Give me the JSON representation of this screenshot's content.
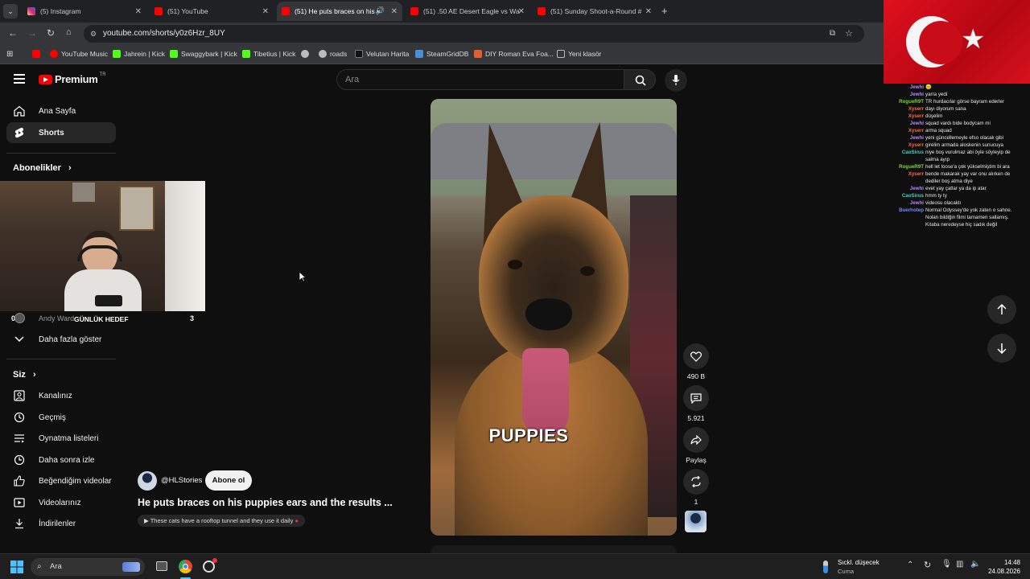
{
  "browser": {
    "tabs": [
      {
        "label": "(5) Instagram",
        "color": "#e1306c"
      },
      {
        "label": "(51) YouTube",
        "color": "#ff0000"
      },
      {
        "label": "(51) He puts braces on his p",
        "color": "#ff0000"
      },
      {
        "label": "(51) .50 AE Desert Eagle vs Wat",
        "color": "#ff0000"
      },
      {
        "label": "(51) Sunday Shoot-a-Round # ",
        "color": "#ff0000"
      }
    ],
    "url": "youtube.com/shorts/y0z6Hzr_8UY",
    "bookmarks": [
      {
        "label": "YouTube Music",
        "color": "#ff0000"
      },
      {
        "label": "Jahrein | Kick",
        "color": "#53fc18"
      },
      {
        "label": "Swaggybark | Kick",
        "color": "#53fc18"
      },
      {
        "label": "Tibetius | Kick",
        "color": "#53fc18"
      },
      {
        "label": "roads",
        "color": "#bbbbbb"
      },
      {
        "label": "Velutan Harita",
        "color": "#333333"
      },
      {
        "label": "SteamGridDB",
        "color": "#4a90d9"
      },
      {
        "label": "DIY Roman Eva Foa...",
        "color": "#e06030"
      },
      {
        "label": "Yeni klasör",
        "color": "#bbbbbb"
      }
    ]
  },
  "header": {
    "brand": "Premium",
    "region": "TR",
    "search_placeholder": "Ara"
  },
  "sidebar": {
    "top": [
      {
        "label": "Ana Sayfa"
      },
      {
        "label": "Shorts"
      }
    ],
    "subscriptions_title": "Abonelikler",
    "channel_partial": "Andy Ward",
    "overlay_goal_label": "GÜNLÜK HEDEF",
    "overlay_left": "0",
    "overlay_right": "3",
    "show_more": "Daha fazla göster",
    "you_title": "Siz",
    "you_items": [
      {
        "label": "Kanalınız"
      },
      {
        "label": "Geçmiş"
      },
      {
        "label": "Oynatma listeleri"
      },
      {
        "label": "Daha sonra izle"
      },
      {
        "label": "Beğendiğim videolar"
      },
      {
        "label": "Videolarınız"
      },
      {
        "label": "İndirilenler"
      }
    ]
  },
  "short": {
    "channel": "@HLStories",
    "subscribe": "Abone ol",
    "title": "He puts braces on his puppies ears and the results ...",
    "related": "These cats have a rooftop tunnel and they use it daily",
    "caption": "PUPPIES",
    "likes": "490 B",
    "comments": "5.921",
    "share": "Paylaş",
    "remix": "1"
  },
  "chat": [
    {
      "user": "Jewhi",
      "msg": "😐",
      "color": "#b388ff"
    },
    {
      "user": "Jewhi",
      "msg": "yarra yedi",
      "color": "#b388ff"
    },
    {
      "user": "RogueR9T",
      "msg": "TR hurdacılar görse bayram ederler",
      "color": "#7fd33a"
    },
    {
      "user": "Xyserr",
      "msg": "dayı diyorum sana",
      "color": "#ff6a3d"
    },
    {
      "user": "Xyserr",
      "msg": "düşelim",
      "color": "#ff6a3d"
    },
    {
      "user": "Jewhi",
      "msg": "squad vardı bide bodycam mi",
      "color": "#b388ff"
    },
    {
      "user": "Xyserr",
      "msg": "arma squad",
      "color": "#ff6a3d"
    },
    {
      "user": "Jewhi",
      "msg": "yeni güncellemeyle efso olacak gibi",
      "color": "#b388ff"
    },
    {
      "user": "Xyserr",
      "msg": "girelim armada aloskenin sunucuya",
      "color": "#ff6a3d"
    },
    {
      "user": "CaoSirus",
      "msg": "niye boş vurulmaz abi öyle söyleyip de",
      "color": "#3fd6c4"
    },
    {
      "user": "",
      "msg": "salma ayıp",
      "color": "#3fd6c4"
    },
    {
      "user": "RogueR9T",
      "msg": "hell let loose'a çok yükselmiştim bi ara",
      "color": "#7fd33a"
    },
    {
      "user": "Xyserr",
      "msg": "bende makarak yay var onu alırken de",
      "color": "#ff6a3d"
    },
    {
      "user": "",
      "msg": "dediler boş atma diye",
      "color": "#ff6a3d"
    },
    {
      "user": "Jewhi",
      "msg": "evet yay çatlar ya da ip atar",
      "color": "#b388ff"
    },
    {
      "user": "CaoSirus",
      "msg": "hmm ty ty",
      "color": "#3fd6c4"
    },
    {
      "user": "Jewhi",
      "msg": "videosu olacaktı",
      "color": "#b388ff"
    },
    {
      "user": "Buerhotep",
      "msg": "Normal Odyssey'de yok zaten o sahne.",
      "color": "#6a8cff"
    },
    {
      "user": "",
      "msg": "Nolan bildiğin filmi tamamen sallamış.",
      "color": "#6a8cff"
    },
    {
      "user": "",
      "msg": "Kitaba neredeyse hiç sadık değil",
      "color": "#6a8cff"
    }
  ],
  "taskbar": {
    "search": "Ara",
    "weather_title": "Sıckl. düşecek",
    "weather_sub": "Cuma",
    "time": "14:48",
    "date": "24.08.2026"
  }
}
